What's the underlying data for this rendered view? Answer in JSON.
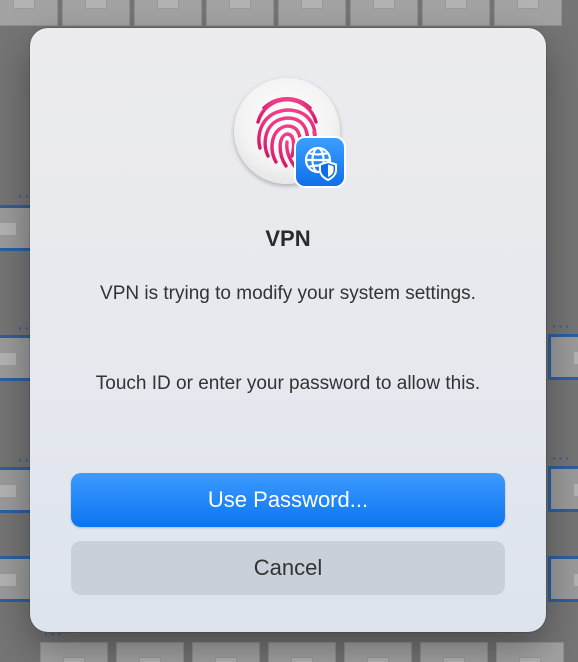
{
  "dialog": {
    "title": "VPN",
    "message": "VPN is trying to modify your system settings.",
    "prompt": "Touch ID or enter your password to allow this.",
    "primary_button": "Use Password...",
    "secondary_button": "Cancel"
  },
  "icons": {
    "app_icon": "fingerprint-icon",
    "badge_icon": "globe-shield-icon"
  },
  "colors": {
    "accent": "#0b74f0",
    "fingerprint": "#e2257a",
    "cancel_bg": "#c9d0d9"
  }
}
